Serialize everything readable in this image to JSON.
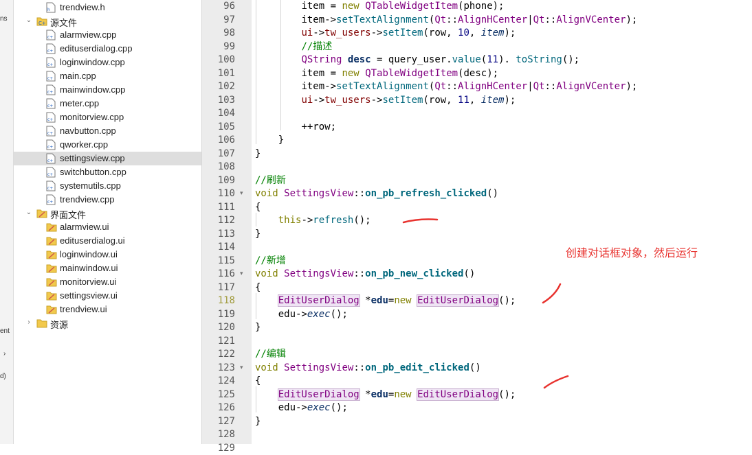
{
  "mode_strip": {
    "labels": [
      "ns",
      "ent",
      "›",
      "d)"
    ]
  },
  "tree": {
    "rows": [
      {
        "kind": "file",
        "type": "h",
        "label": "trendview.h"
      },
      {
        "kind": "folder",
        "type": "src",
        "label": "源文件",
        "expanded": true
      },
      {
        "kind": "file",
        "type": "cpp",
        "label": "alarmview.cpp"
      },
      {
        "kind": "file",
        "type": "cpp",
        "label": "edituserdialog.cpp"
      },
      {
        "kind": "file",
        "type": "cpp",
        "label": "loginwindow.cpp"
      },
      {
        "kind": "file",
        "type": "cpp",
        "label": "main.cpp"
      },
      {
        "kind": "file",
        "type": "cpp",
        "label": "mainwindow.cpp"
      },
      {
        "kind": "file",
        "type": "cpp",
        "label": "meter.cpp"
      },
      {
        "kind": "file",
        "type": "cpp",
        "label": "monitorview.cpp"
      },
      {
        "kind": "file",
        "type": "cpp",
        "label": "navbutton.cpp"
      },
      {
        "kind": "file",
        "type": "cpp",
        "label": "qworker.cpp"
      },
      {
        "kind": "file",
        "type": "cpp",
        "label": "settingsview.cpp",
        "selected": true
      },
      {
        "kind": "file",
        "type": "cpp",
        "label": "switchbutton.cpp"
      },
      {
        "kind": "file",
        "type": "cpp",
        "label": "systemutils.cpp"
      },
      {
        "kind": "file",
        "type": "cpp",
        "label": "trendview.cpp"
      },
      {
        "kind": "folder",
        "type": "ui",
        "label": "界面文件",
        "expanded": true
      },
      {
        "kind": "file",
        "type": "ui",
        "label": "alarmview.ui"
      },
      {
        "kind": "file",
        "type": "ui",
        "label": "edituserdialog.ui"
      },
      {
        "kind": "file",
        "type": "ui",
        "label": "loginwindow.ui"
      },
      {
        "kind": "file",
        "type": "ui",
        "label": "mainwindow.ui"
      },
      {
        "kind": "file",
        "type": "ui",
        "label": "monitorview.ui"
      },
      {
        "kind": "file",
        "type": "ui",
        "label": "settingsview.ui"
      },
      {
        "kind": "file",
        "type": "ui",
        "label": "trendview.ui"
      },
      {
        "kind": "folder",
        "type": "res",
        "label": "资源",
        "expanded": false
      }
    ]
  },
  "editor": {
    "current_line": "118",
    "lines": [
      {
        "no": "96",
        "fold": "",
        "tokens": [
          [
            "",
            "        "
          ],
          [
            "",
            "item = "
          ],
          [
            "k",
            "new"
          ],
          [
            "",
            " "
          ],
          [
            "t",
            "QTableWidgetItem"
          ],
          [
            "",
            "(phone);"
          ]
        ]
      },
      {
        "no": "97",
        "fold": "",
        "tokens": [
          [
            "",
            "        "
          ],
          [
            "",
            "item->"
          ],
          [
            "f",
            "setTextAlignment"
          ],
          [
            "",
            "("
          ],
          [
            "t",
            "Qt"
          ],
          [
            "",
            "::"
          ],
          [
            "t",
            "AlignHCenter"
          ],
          [
            "",
            "|"
          ],
          [
            "t",
            "Qt"
          ],
          [
            "",
            "::"
          ],
          [
            "t",
            "AlignVCenter"
          ],
          [
            "",
            ");"
          ]
        ]
      },
      {
        "no": "98",
        "fold": "",
        "tokens": [
          [
            "",
            "        "
          ],
          [
            "m",
            "ui"
          ],
          [
            "",
            "->"
          ],
          [
            "m",
            "tw_users"
          ],
          [
            "",
            "->"
          ],
          [
            "f",
            "setItem"
          ],
          [
            "",
            "(row, "
          ],
          [
            "n",
            "10"
          ],
          [
            "",
            ", "
          ],
          [
            "it",
            "item"
          ],
          [
            "",
            ");"
          ]
        ]
      },
      {
        "no": "99",
        "fold": "",
        "tokens": [
          [
            "",
            "        "
          ],
          [
            "c",
            "//描述"
          ]
        ]
      },
      {
        "no": "100",
        "fold": "",
        "tokens": [
          [
            "",
            "        "
          ],
          [
            "t",
            "QString"
          ],
          [
            "",
            " "
          ],
          [
            "b",
            "desc"
          ],
          [
            "",
            " = query_user."
          ],
          [
            "f",
            "value"
          ],
          [
            "",
            "("
          ],
          [
            "n",
            "11"
          ],
          [
            "",
            "). "
          ],
          [
            "f",
            "toString"
          ],
          [
            "",
            "();"
          ]
        ]
      },
      {
        "no": "101",
        "fold": "",
        "tokens": [
          [
            "",
            "        "
          ],
          [
            "",
            "item = "
          ],
          [
            "k",
            "new"
          ],
          [
            "",
            " "
          ],
          [
            "t",
            "QTableWidgetItem"
          ],
          [
            "",
            "(desc);"
          ]
        ]
      },
      {
        "no": "102",
        "fold": "",
        "tokens": [
          [
            "",
            "        "
          ],
          [
            "",
            "item->"
          ],
          [
            "f",
            "setTextAlignment"
          ],
          [
            "",
            "("
          ],
          [
            "t",
            "Qt"
          ],
          [
            "",
            "::"
          ],
          [
            "t",
            "AlignHCenter"
          ],
          [
            "",
            "|"
          ],
          [
            "t",
            "Qt"
          ],
          [
            "",
            "::"
          ],
          [
            "t",
            "AlignVCenter"
          ],
          [
            "",
            ");"
          ]
        ]
      },
      {
        "no": "103",
        "fold": "",
        "tokens": [
          [
            "",
            "        "
          ],
          [
            "m",
            "ui"
          ],
          [
            "",
            "->"
          ],
          [
            "m",
            "tw_users"
          ],
          [
            "",
            "->"
          ],
          [
            "f",
            "setItem"
          ],
          [
            "",
            "(row, "
          ],
          [
            "n",
            "11"
          ],
          [
            "",
            ", "
          ],
          [
            "it",
            "item"
          ],
          [
            "",
            ");"
          ]
        ]
      },
      {
        "no": "104",
        "fold": "",
        "tokens": []
      },
      {
        "no": "105",
        "fold": "",
        "tokens": [
          [
            "",
            "        "
          ],
          [
            "",
            "++row;"
          ]
        ]
      },
      {
        "no": "106",
        "fold": "",
        "tokens": [
          [
            "",
            "    "
          ],
          [
            "",
            "}"
          ]
        ]
      },
      {
        "no": "107",
        "fold": "",
        "tokens": [
          [
            "",
            "}"
          ]
        ]
      },
      {
        "no": "108",
        "fold": "",
        "tokens": []
      },
      {
        "no": "109",
        "fold": "",
        "tokens": [
          [
            "c",
            "//刷新"
          ]
        ]
      },
      {
        "no": "110",
        "fold": "▾",
        "tokens": [
          [
            "k",
            "void"
          ],
          [
            "",
            " "
          ],
          [
            "t",
            "SettingsView"
          ],
          [
            "",
            "::"
          ],
          [
            "fb",
            "on_pb_refresh_clicked"
          ],
          [
            "",
            "()"
          ]
        ]
      },
      {
        "no": "111",
        "fold": "",
        "tokens": [
          [
            "",
            "{"
          ]
        ]
      },
      {
        "no": "112",
        "fold": "",
        "tokens": [
          [
            "",
            "    "
          ],
          [
            "k",
            "this"
          ],
          [
            "",
            "->"
          ],
          [
            "f",
            "refresh"
          ],
          [
            "",
            "();"
          ]
        ]
      },
      {
        "no": "113",
        "fold": "",
        "tokens": [
          [
            "",
            "}"
          ]
        ]
      },
      {
        "no": "114",
        "fold": "",
        "tokens": []
      },
      {
        "no": "115",
        "fold": "",
        "tokens": [
          [
            "c",
            "//新增"
          ]
        ]
      },
      {
        "no": "116",
        "fold": "▾",
        "tokens": [
          [
            "k",
            "void"
          ],
          [
            "",
            " "
          ],
          [
            "t",
            "SettingsView"
          ],
          [
            "",
            "::"
          ],
          [
            "fb",
            "on_pb_new_clicked"
          ],
          [
            "",
            "()"
          ]
        ]
      },
      {
        "no": "117",
        "fold": "",
        "tokens": [
          [
            "",
            "{"
          ]
        ]
      },
      {
        "no": "118",
        "fold": "",
        "tokens": [
          [
            "",
            "    "
          ],
          [
            "hl",
            "EditUserDialog"
          ],
          [
            "",
            " *"
          ],
          [
            "b",
            "edu"
          ],
          [
            "",
            "="
          ],
          [
            "k",
            "new"
          ],
          [
            "",
            " "
          ],
          [
            "hl",
            "EditUserDialog"
          ],
          [
            "",
            "();"
          ]
        ]
      },
      {
        "no": "119",
        "fold": "",
        "tokens": [
          [
            "",
            "    "
          ],
          [
            "",
            "edu->"
          ],
          [
            "it",
            "exec"
          ],
          [
            "",
            "();"
          ]
        ]
      },
      {
        "no": "120",
        "fold": "",
        "tokens": [
          [
            "",
            "}"
          ]
        ]
      },
      {
        "no": "121",
        "fold": "",
        "tokens": []
      },
      {
        "no": "122",
        "fold": "",
        "tokens": [
          [
            "c",
            "//编辑"
          ]
        ]
      },
      {
        "no": "123",
        "fold": "▾",
        "tokens": [
          [
            "k",
            "void"
          ],
          [
            "",
            " "
          ],
          [
            "t",
            "SettingsView"
          ],
          [
            "",
            "::"
          ],
          [
            "fb",
            "on_pb_edit_clicked"
          ],
          [
            "",
            "()"
          ]
        ]
      },
      {
        "no": "124",
        "fold": "",
        "tokens": [
          [
            "",
            "{"
          ]
        ]
      },
      {
        "no": "125",
        "fold": "",
        "tokens": [
          [
            "",
            "    "
          ],
          [
            "hl",
            "EditUserDialog"
          ],
          [
            "",
            " *"
          ],
          [
            "b",
            "edu"
          ],
          [
            "",
            "="
          ],
          [
            "k",
            "new"
          ],
          [
            "",
            " "
          ],
          [
            "hl",
            "EditUserDialog"
          ],
          [
            "",
            "();"
          ]
        ]
      },
      {
        "no": "126",
        "fold": "",
        "tokens": [
          [
            "",
            "    "
          ],
          [
            "",
            "edu->"
          ],
          [
            "it",
            "exec"
          ],
          [
            "",
            "();"
          ]
        ]
      },
      {
        "no": "127",
        "fold": "",
        "tokens": [
          [
            "",
            "}"
          ]
        ]
      },
      {
        "no": "128",
        "fold": "",
        "tokens": []
      },
      {
        "no": "129",
        "fold": "",
        "tokens": []
      }
    ]
  },
  "annotation": {
    "text": "创建对话框对象，然后运行",
    "color": "#e8322e"
  }
}
